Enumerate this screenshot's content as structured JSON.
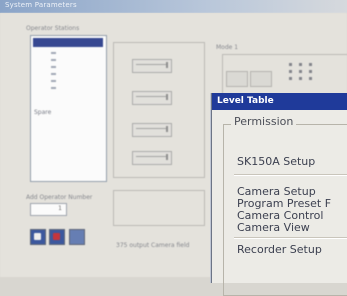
{
  "app": {
    "title": "System Parameters"
  },
  "background": {
    "section_label": "Operator Stations",
    "station_list_bottom": "Spare",
    "operator_number_label": "Add Operator Number",
    "operator_number_value": "1",
    "mode_label": "Mode 1",
    "status_text": "375 output Camera field"
  },
  "level_table": {
    "title": "Level Table",
    "group_label": "Permission",
    "items": [
      "SK150A Setup",
      "Camera Setup",
      "Program Preset F",
      "Camera Control",
      "Camera View",
      "Recorder Setup"
    ]
  }
}
